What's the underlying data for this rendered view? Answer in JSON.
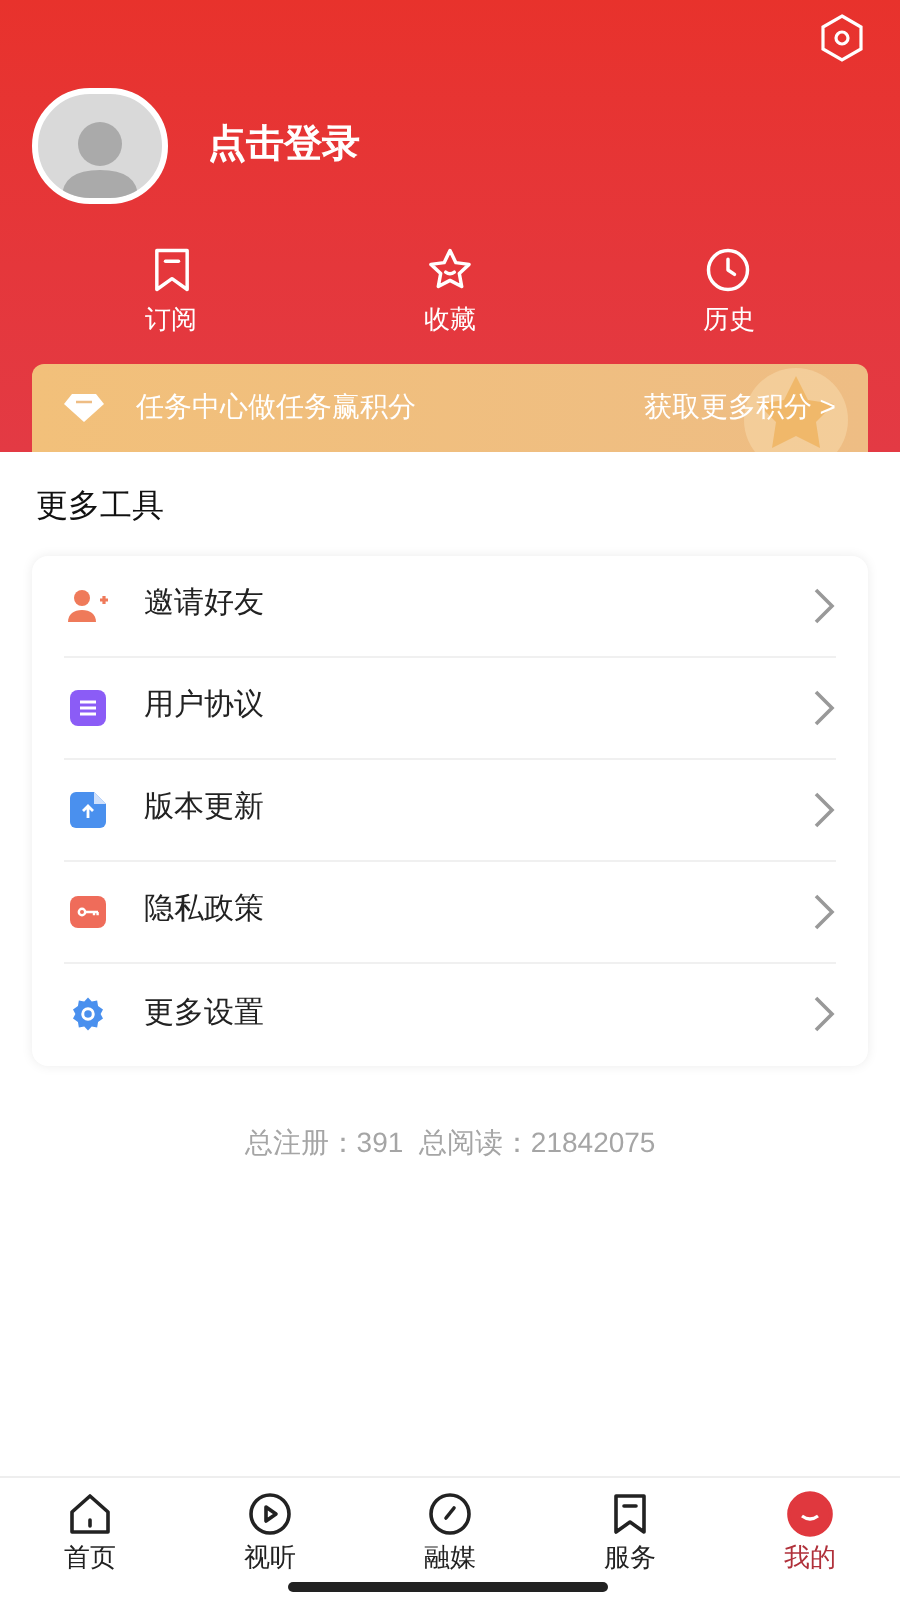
{
  "profile": {
    "login_label": "点击登录"
  },
  "shortcuts": [
    {
      "kind": "bookmark",
      "label": "订阅"
    },
    {
      "kind": "star",
      "label": "收藏"
    },
    {
      "kind": "clock",
      "label": "历史"
    }
  ],
  "task_banner": {
    "text": "任务中心做任务赢积分",
    "link": "获取更多积分 >"
  },
  "tools": {
    "title": "更多工具",
    "items": [
      {
        "kind": "invite",
        "label": "邀请好友"
      },
      {
        "kind": "agreement",
        "label": "用户协议"
      },
      {
        "kind": "update",
        "label": "版本更新"
      },
      {
        "kind": "privacy",
        "label": "隐私政策"
      },
      {
        "kind": "settings",
        "label": "更多设置"
      }
    ]
  },
  "stats": "总注册：391  总阅读：21842075",
  "tabs": [
    {
      "kind": "home",
      "label": "首页",
      "selected": false
    },
    {
      "kind": "play",
      "label": "视听",
      "selected": false
    },
    {
      "kind": "gauge",
      "label": "融媒",
      "selected": false
    },
    {
      "kind": "bookmark",
      "label": "服务",
      "selected": false
    },
    {
      "kind": "me",
      "label": "我的",
      "selected": true
    }
  ]
}
